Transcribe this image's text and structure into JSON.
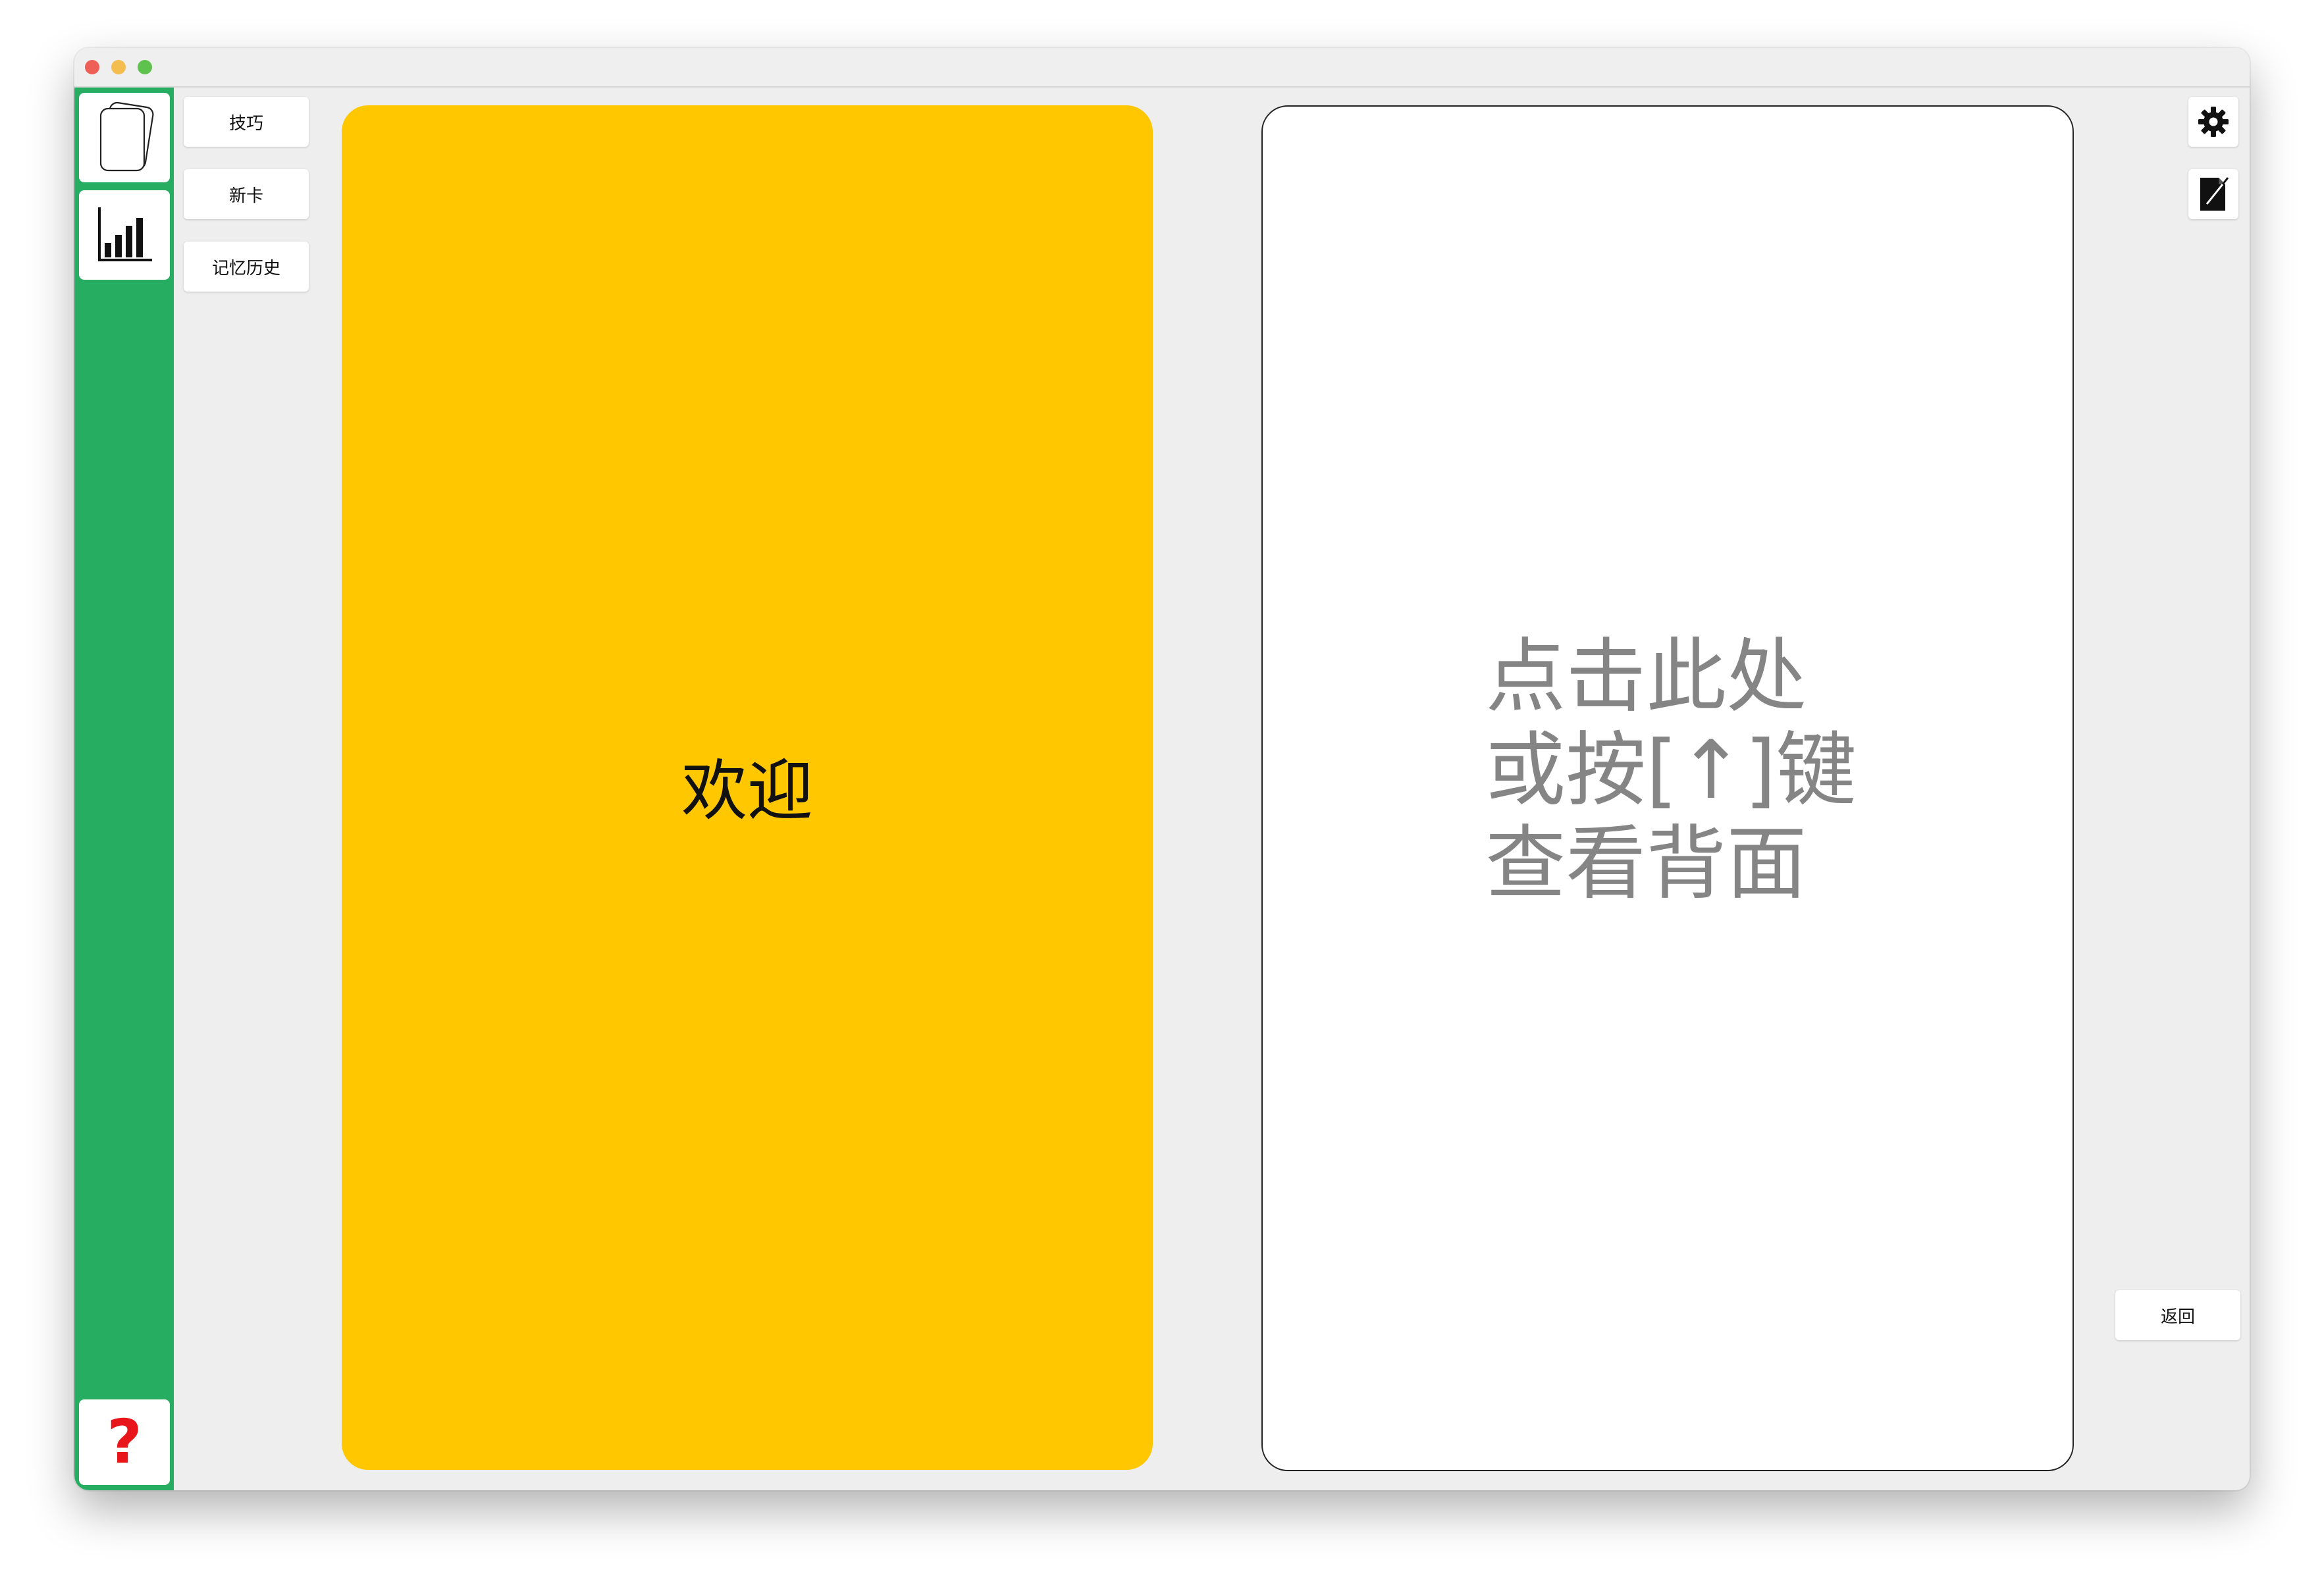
{
  "colors": {
    "sidebar": "#26ad62",
    "front_card": "#fec700",
    "back_card": "#ffffff",
    "back_text": "#858585",
    "help_icon": "#e8161b"
  },
  "sidebar": {
    "items": [
      {
        "icon": "cards-stack-icon"
      },
      {
        "icon": "bar-chart-icon"
      }
    ],
    "help": {
      "icon": "help-icon",
      "glyph": "?"
    }
  },
  "menu": {
    "tips_label": "技巧",
    "new_card_label": "新卡",
    "history_label": "记忆历史"
  },
  "card": {
    "front_text": "欢迎",
    "back_hint": "点击此处\n或按[↑]键\n查看背面"
  },
  "tools": {
    "settings_icon": "gear-icon",
    "edit_icon": "edit-document-icon"
  },
  "actions": {
    "back_label": "返回"
  }
}
